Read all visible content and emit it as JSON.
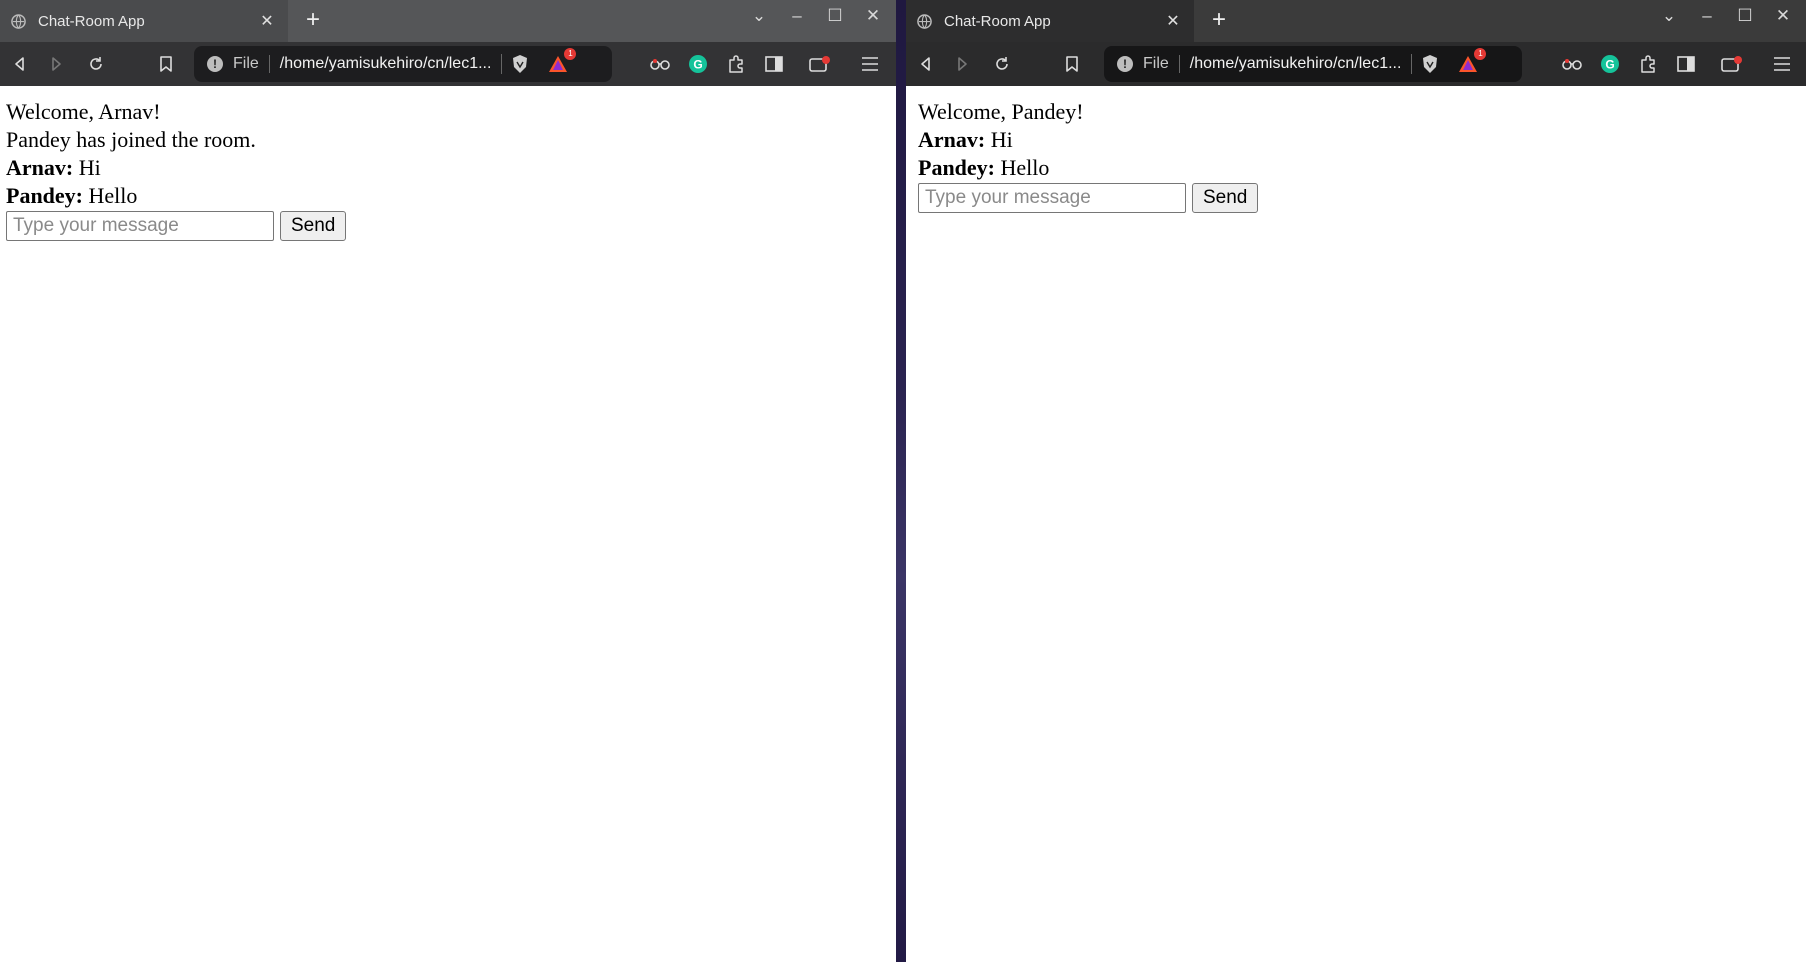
{
  "left_window": {
    "tab_title": "Chat-Room App",
    "url_scheme": "File",
    "url": "/home/yamisukehiro/cn/lec1...",
    "brave_badge": "1",
    "chat": {
      "welcome": "Welcome, Arnav!",
      "system_note": "Pandey has joined the room.",
      "messages": [
        {
          "sender": "Arnav:",
          "text": "Hi"
        },
        {
          "sender": "Pandey:",
          "text": "Hello"
        }
      ],
      "input_placeholder": "Type your message",
      "send_label": "Send"
    }
  },
  "right_window": {
    "tab_title": "Chat-Room App",
    "url_scheme": "File",
    "url": "/home/yamisukehiro/cn/lec1...",
    "brave_badge": "1",
    "chat": {
      "welcome": "Welcome, Pandey!",
      "messages": [
        {
          "sender": "Arnav:",
          "text": "Hi"
        },
        {
          "sender": "Pandey:",
          "text": "Hello"
        }
      ],
      "input_placeholder": "Type your message",
      "send_label": "Send"
    }
  },
  "colors": {
    "grammarly": "#15c39a",
    "brave_orange": "#fb542b",
    "notification_red": "#e53935"
  }
}
